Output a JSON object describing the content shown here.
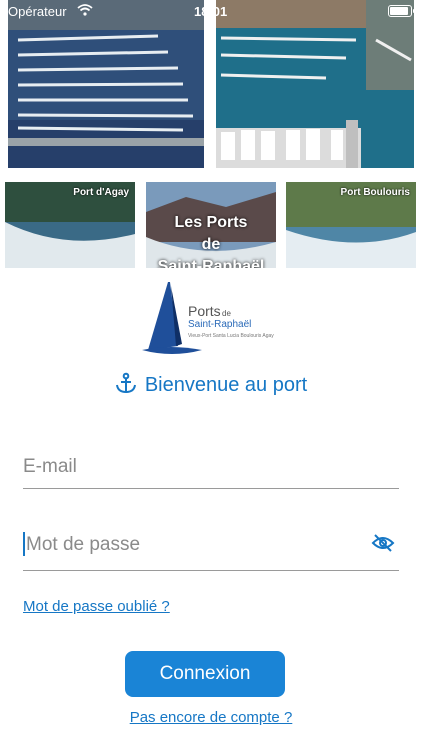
{
  "status_bar": {
    "carrier": "Opérateur",
    "time": "18:01"
  },
  "tiles": {
    "agay": "Port d'Agay",
    "center_line1": "Les Ports",
    "center_line2": "de",
    "center_line3": "Saint-Raphaël",
    "boulouris": "Port Boulouris"
  },
  "logo": {
    "title": "Ports",
    "title_small": "de",
    "subtitle": "Saint-Raphaël",
    "ports_list": "Vieux-Port  Santa Lucia  Boulouris  Agay"
  },
  "welcome": "Bienvenue au port",
  "form": {
    "email_placeholder": "E-mail",
    "password_placeholder": "Mot de passe",
    "forgot_link": "Mot de passe oublié ?",
    "login_button": "Connexion",
    "signup_link": "Pas encore de compte ?"
  },
  "colors": {
    "accent": "#1677c5",
    "button": "#1a84d6"
  },
  "icons": [
    "wifi-icon",
    "battery-icon",
    "anchor-icon",
    "eye-off-icon"
  ]
}
